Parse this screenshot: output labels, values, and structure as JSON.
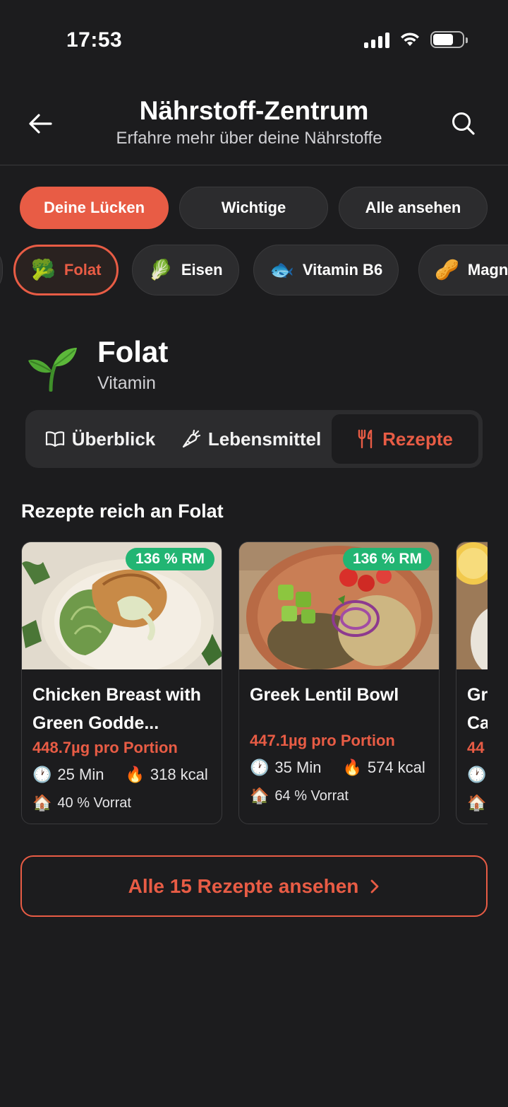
{
  "status_bar": {
    "time": "17:53"
  },
  "header": {
    "title": "Nährstoff-Zentrum",
    "subtitle": "Erfahre mehr über deine Nährstoffe"
  },
  "filters": [
    {
      "label": "Deine Lücken",
      "active": true
    },
    {
      "label": "Wichtige",
      "active": false
    },
    {
      "label": "Alle ansehen",
      "active": false
    }
  ],
  "nutrient_chips": [
    {
      "emoji": "🥦",
      "label": "Folat",
      "active": true
    },
    {
      "emoji": "🥬",
      "label": "Eisen",
      "active": false
    },
    {
      "emoji": "🐟",
      "label": "Vitamin B6",
      "active": false
    },
    {
      "emoji": "🥜",
      "label": "Magnesium",
      "active": false
    }
  ],
  "nutrient": {
    "name": "Folat",
    "type": "Vitamin",
    "icon": "sprout-icon"
  },
  "segments": [
    {
      "label": "Überblick",
      "icon": "book-icon"
    },
    {
      "label": "Lebensmittel",
      "icon": "carrot-icon"
    },
    {
      "label": "Rezepte",
      "icon": "cutlery-icon",
      "active": true
    }
  ],
  "section_title": "Rezepte reich an Folat",
  "recipes": [
    {
      "badge": "136 % RM",
      "title": "Chicken Breast with Green Godde...",
      "portion": "448.7µg pro Portion",
      "time": "25 Min",
      "kcal": "318 kcal",
      "stock": "40 % Vorrat"
    },
    {
      "badge": "136 % RM",
      "title": "Greek Lentil Bowl",
      "portion": "447.1µg pro Portion",
      "time": "35 Min",
      "kcal": "574 kcal",
      "stock": "64 % Vorrat"
    },
    {
      "title_partial": "Gr",
      "title_partial_2": "Ca",
      "portion_partial": "44"
    }
  ],
  "cta": {
    "label": "Alle 15 Rezepte ansehen"
  },
  "colors": {
    "accent": "#e85c45",
    "badge": "#22b573",
    "background": "#1c1c1e",
    "surface": "#2c2c2e"
  }
}
